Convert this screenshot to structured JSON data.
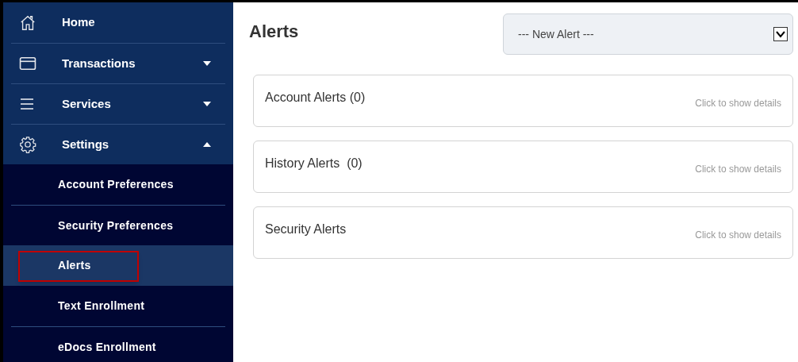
{
  "sidebar": {
    "items": [
      {
        "label": "Home"
      },
      {
        "label": "Transactions",
        "expanded": false
      },
      {
        "label": "Services",
        "expanded": false
      },
      {
        "label": "Settings",
        "expanded": true,
        "children": [
          {
            "label": "Account Preferences",
            "selected": false,
            "outlined": false
          },
          {
            "label": "Security Preferences",
            "selected": false,
            "outlined": false
          },
          {
            "label": "Alerts",
            "selected": true,
            "outlined": true
          },
          {
            "label": "Text Enrollment",
            "selected": false,
            "outlined": false
          },
          {
            "label": "eDocs Enrollment",
            "selected": false,
            "outlined": false
          }
        ]
      }
    ]
  },
  "page": {
    "title": "Alerts",
    "new_alert_select": {
      "value": "--- New Alert ---"
    },
    "panels": [
      {
        "title": "Account Alerts (0)",
        "hint": "Click to show details"
      },
      {
        "title": "History Alerts  (0)",
        "hint": "Click to show details"
      },
      {
        "title": "Security Alerts",
        "hint": "Click to show details"
      }
    ]
  }
}
